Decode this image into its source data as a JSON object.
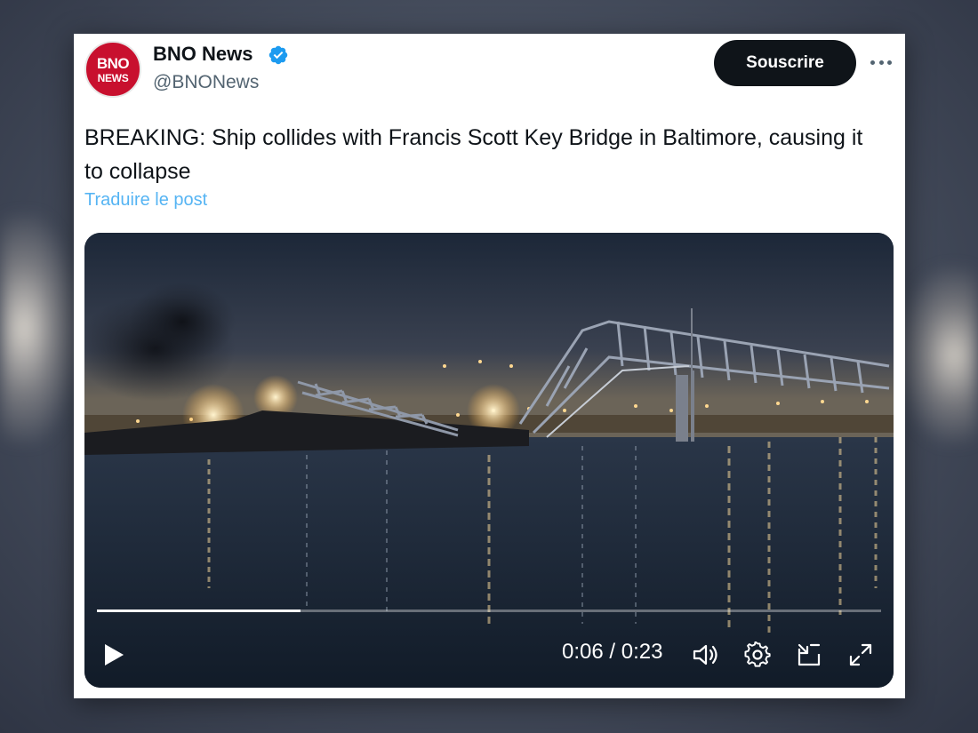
{
  "tweet": {
    "author": {
      "name": "BNO News",
      "handle": "@BNONews",
      "avatar_line1": "BNO",
      "avatar_line2": "NEWS",
      "verified": true
    },
    "follow_label": "Souscrire",
    "text": "BREAKING: Ship collides with Francis Scott Key Bridge in Baltimore, causing it to collapse",
    "translate_label": "Traduire le post",
    "video": {
      "time_display": "0:06 / 0:23",
      "progress": 0.26
    }
  },
  "colors": {
    "brand_red": "#c8102e",
    "link_blue": "#1d9bf0",
    "button_dark": "#0f1419",
    "secondary_text": "#536471"
  },
  "icons": [
    "verified-badge-icon",
    "more-icon",
    "play-icon",
    "volume-icon",
    "settings-icon",
    "pip-icon",
    "fullscreen-icon"
  ]
}
